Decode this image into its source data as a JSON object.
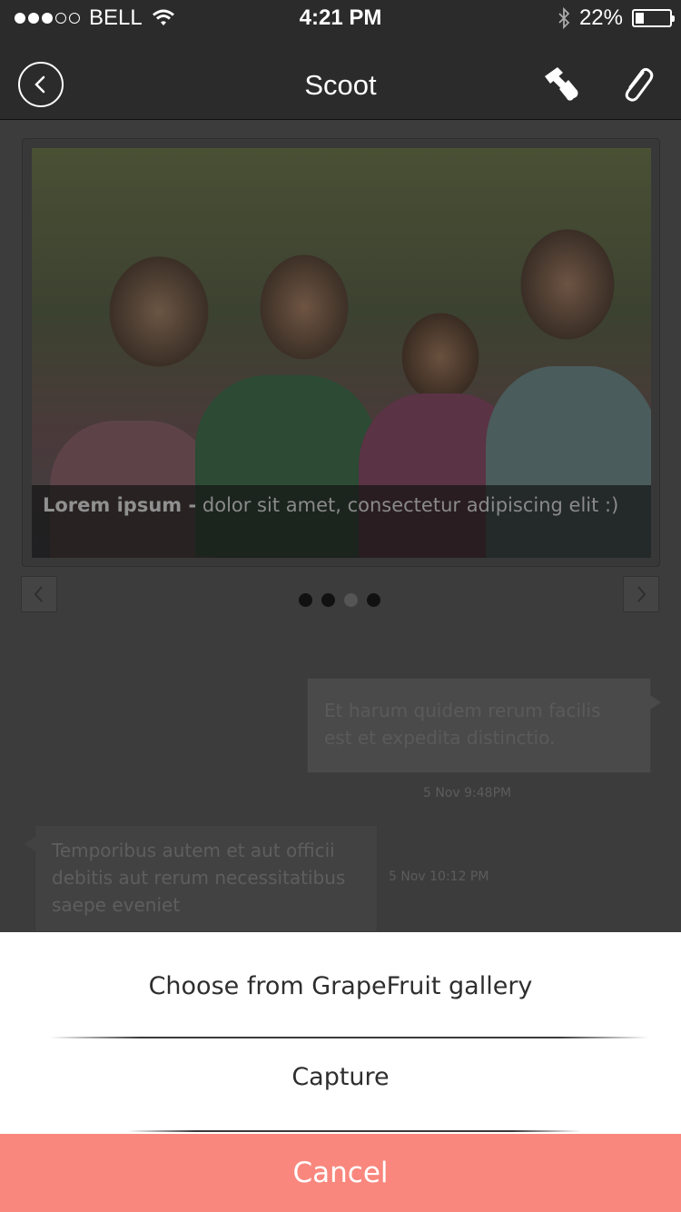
{
  "status_bar": {
    "carrier": "BELL",
    "time": "4:21 PM",
    "battery": "22%",
    "battery_level": 0.22
  },
  "nav": {
    "title": "Scoot",
    "back_icon": "chevron-left-icon",
    "brush_icon": "paint-brush-icon",
    "attach_icon": "paperclip-icon"
  },
  "feed": {
    "photo_caption_bold": "Lorem ipsum -",
    "photo_caption_rest": "dolor sit amet, consectetur adipiscing elit :)",
    "pager": {
      "count": 4,
      "active_index": 2
    },
    "messages": [
      {
        "side": "right",
        "text": "Et harum quidem rerum facilis est et expedita distinctio.",
        "timestamp": "5 Nov 9:48PM"
      },
      {
        "side": "left",
        "text": "Temporibus autem et aut officii debitis aut rerum necessitatibus saepe eveniet",
        "timestamp": "5 Nov 10:12 PM"
      }
    ]
  },
  "action_sheet": {
    "options": [
      "Choose from GrapeFruit gallery",
      "Capture"
    ],
    "cancel_label": "Cancel",
    "cancel_color": "#f9877d"
  }
}
